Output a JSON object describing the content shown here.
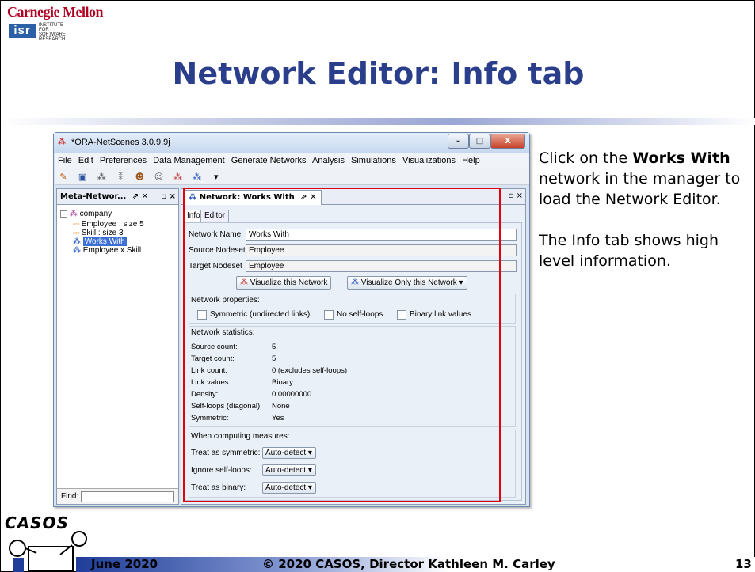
{
  "header": {
    "org": "Carnegie Mellon",
    "isr_abbr": "isr",
    "isr_text": "institute for SOFTWARE RESEARCH",
    "title": "Network Editor: Info tab"
  },
  "window": {
    "title": "*ORA-NetScenes 3.0.9.9j",
    "controls": {
      "minimize": "–",
      "maximize": "□",
      "close": "X"
    },
    "menu": [
      "File",
      "Edit",
      "Preferences",
      "Data Management",
      "Generate Networks",
      "Analysis",
      "Simulations",
      "Visualizations",
      "Help"
    ],
    "toolbar_icons": [
      "zoom-icon",
      "save-icon",
      "network-icon",
      "network2-icon",
      "user-icon",
      "users-icon",
      "graph-icon",
      "graph2-icon",
      "dropdown-icon"
    ]
  },
  "meta_panel": {
    "tab_label": "Meta-Networ...",
    "tab_pin": "⇗ ✕",
    "tree": {
      "root": "company",
      "items": [
        "Employee : size 5",
        "Skill : size 3",
        "Works With",
        "Employee x Skill"
      ],
      "selected": "Works With"
    },
    "find_label": "Find:"
  },
  "editor": {
    "tab_label": "Network: Works With",
    "tab_pin": "⇗ ✕",
    "subtabs": [
      "Info",
      "Editor"
    ],
    "fields": {
      "network_name_label": "Network Name",
      "network_name_value": "Works With",
      "source_label": "Source Nodeset",
      "source_value": "Employee",
      "target_label": "Target Nodeset",
      "target_value": "Employee"
    },
    "buttons": {
      "visualize": "Visualize this Network",
      "visualize_only": "Visualize Only this Network"
    },
    "properties": {
      "heading": "Network properties:",
      "checks": [
        {
          "label": "Symmetric (undirected links)",
          "checked": false
        },
        {
          "label": "No self-loops",
          "checked": false
        },
        {
          "label": "Binary link values",
          "checked": false
        }
      ]
    },
    "statistics": {
      "heading": "Network statistics:",
      "rows": [
        {
          "k": "Source count:",
          "v": "5"
        },
        {
          "k": "Target count:",
          "v": "5"
        },
        {
          "k": "Link count:",
          "v": "0 (excludes self-loops)"
        },
        {
          "k": "Link values:",
          "v": "Binary"
        },
        {
          "k": "Density:",
          "v": "0.00000000"
        },
        {
          "k": "Self-loops (diagonal):",
          "v": "None"
        },
        {
          "k": "Symmetric:",
          "v": "Yes"
        }
      ]
    },
    "computing": {
      "heading": "When computing measures:",
      "rows": [
        {
          "label": "Treat as symmetric:",
          "value": "Auto-detect"
        },
        {
          "label": "Ignore self-loops:",
          "value": "Auto-detect"
        },
        {
          "label": "Treat as binary:",
          "value": "Auto-detect"
        }
      ]
    }
  },
  "side_text": {
    "p1_pre": "Click on the ",
    "p1_bold": "Works With",
    "p1_post": " network in the manager to load the Network Editor.",
    "p2": "The Info tab shows high level information."
  },
  "footer": {
    "date": "June 2020",
    "copyright": "© 2020 CASOS, Director Kathleen M. Carley",
    "page": "13",
    "casos_logo": "CASOS"
  },
  "colors": {
    "title": "#2a3e8c",
    "highlight_box": "#e00010",
    "cmu_red": "#b00020"
  }
}
